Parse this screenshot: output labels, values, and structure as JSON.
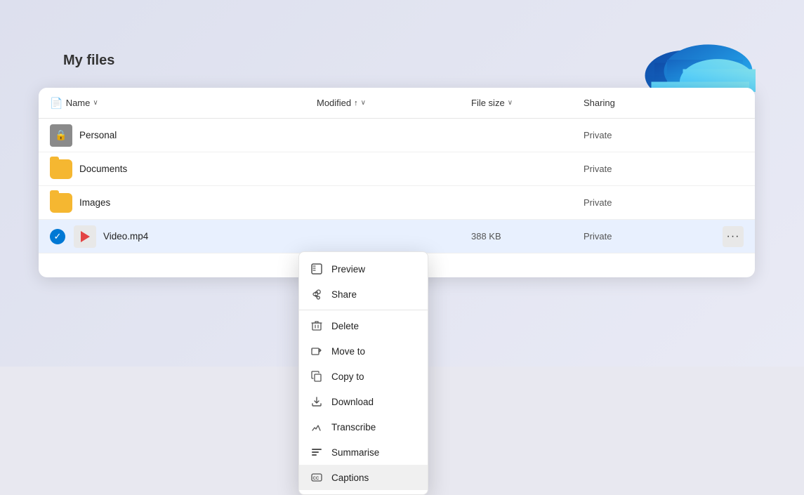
{
  "page": {
    "title": "My files",
    "background": "#e8e8f0"
  },
  "header": {
    "name_col": "Name",
    "modified_col": "Modified",
    "filesize_col": "File size",
    "sharing_col": "Sharing",
    "modified_sort": "↑",
    "name_chevron": "∨",
    "modified_chevron": "∨",
    "filesize_chevron": "∨"
  },
  "rows": [
    {
      "id": "personal",
      "name": "Personal",
      "icon_type": "personal",
      "modified": "",
      "filesize": "",
      "sharing": "Private",
      "selected": false
    },
    {
      "id": "documents",
      "name": "Documents",
      "icon_type": "folder",
      "modified": "",
      "filesize": "",
      "sharing": "Private",
      "selected": false
    },
    {
      "id": "images",
      "name": "Images",
      "icon_type": "folder",
      "modified": "",
      "filesize": "",
      "sharing": "Private",
      "selected": false
    },
    {
      "id": "video",
      "name": "Video.mp4",
      "icon_type": "video",
      "modified": "",
      "filesize": "388 KB",
      "sharing": "Private",
      "selected": true
    }
  ],
  "context_menu": {
    "items": [
      {
        "id": "preview",
        "label": "Preview",
        "icon": "preview"
      },
      {
        "id": "share",
        "label": "Share",
        "icon": "share"
      },
      {
        "id": "delete",
        "label": "Delete",
        "icon": "delete"
      },
      {
        "id": "move-to",
        "label": "Move to",
        "icon": "move"
      },
      {
        "id": "copy-to",
        "label": "Copy to",
        "icon": "copy"
      },
      {
        "id": "download",
        "label": "Download",
        "icon": "download"
      },
      {
        "id": "transcribe",
        "label": "Transcribe",
        "icon": "transcribe"
      },
      {
        "id": "summarise",
        "label": "Summarise",
        "icon": "summarise"
      },
      {
        "id": "captions",
        "label": "Captions",
        "icon": "captions"
      }
    ]
  },
  "three_dots_label": "···"
}
